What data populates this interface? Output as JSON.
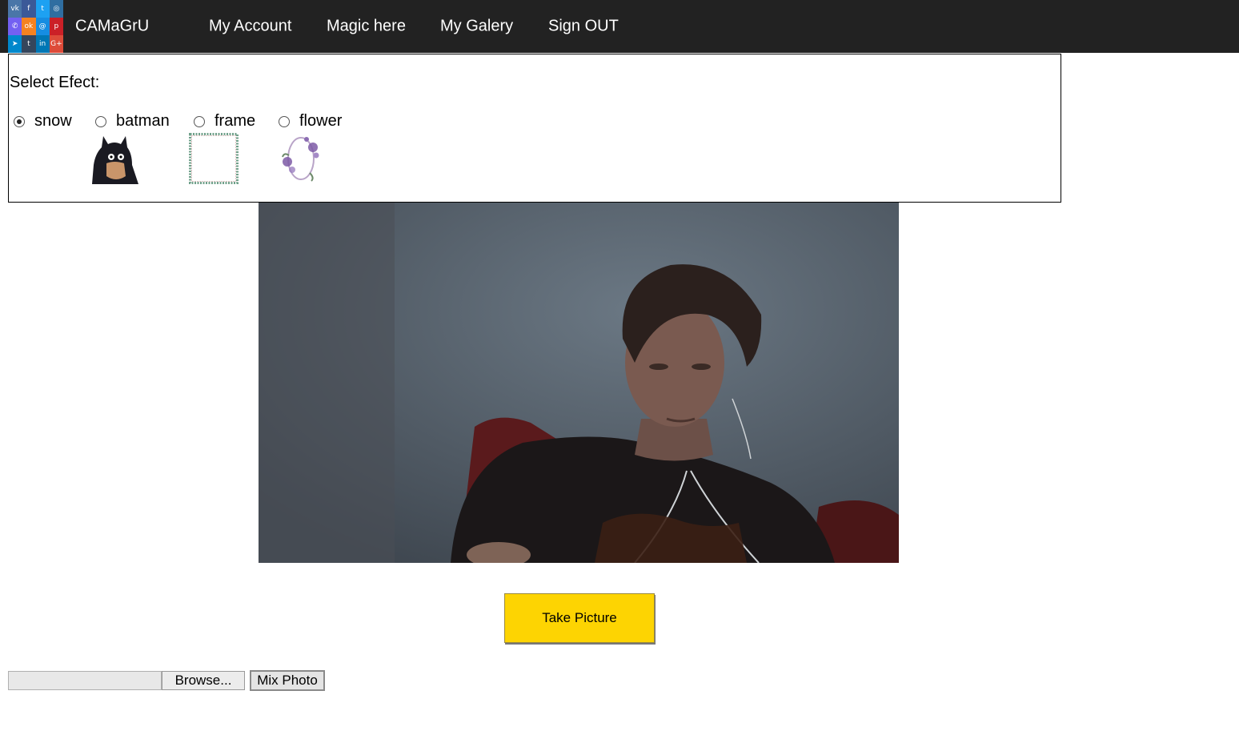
{
  "header": {
    "brand": "CAMaGrU",
    "nav": [
      {
        "label": "My Account"
      },
      {
        "label": "Magic here"
      },
      {
        "label": "My Galery"
      },
      {
        "label": "Sign OUT"
      }
    ],
    "social_icons": [
      {
        "name": "vk-icon",
        "glyph": "vk",
        "color": "#4a76a8"
      },
      {
        "name": "facebook-icon",
        "glyph": "f",
        "color": "#3b5998"
      },
      {
        "name": "twitter-icon",
        "glyph": "t",
        "color": "#1da1f2"
      },
      {
        "name": "instagram-icon",
        "glyph": "◎",
        "color": "#2f6ea1"
      },
      {
        "name": "viber-icon",
        "glyph": "✆",
        "color": "#7360f2"
      },
      {
        "name": "odnoklassniki-icon",
        "glyph": "ok",
        "color": "#f58220"
      },
      {
        "name": "moimir-icon",
        "glyph": "@",
        "color": "#168de2"
      },
      {
        "name": "pinterest-icon",
        "glyph": "p",
        "color": "#cb2027"
      },
      {
        "name": "telegram-icon",
        "glyph": "➤",
        "color": "#0088cc"
      },
      {
        "name": "tumblr-icon",
        "glyph": "t",
        "color": "#35465c"
      },
      {
        "name": "linkedin-icon",
        "glyph": "in",
        "color": "#0077b5"
      },
      {
        "name": "googleplus-icon",
        "glyph": "G+",
        "color": "#dd4b39"
      }
    ]
  },
  "effects": {
    "title": "Select Efect:",
    "options": [
      {
        "label": "snow",
        "checked": true
      },
      {
        "label": "batman",
        "checked": false
      },
      {
        "label": "frame",
        "checked": false
      },
      {
        "label": "flower",
        "checked": false
      }
    ]
  },
  "camera": {
    "take_label": "Take Picture"
  },
  "upload": {
    "file_value": "",
    "browse_label": "Browse...",
    "mix_label": "Mix Photo"
  }
}
